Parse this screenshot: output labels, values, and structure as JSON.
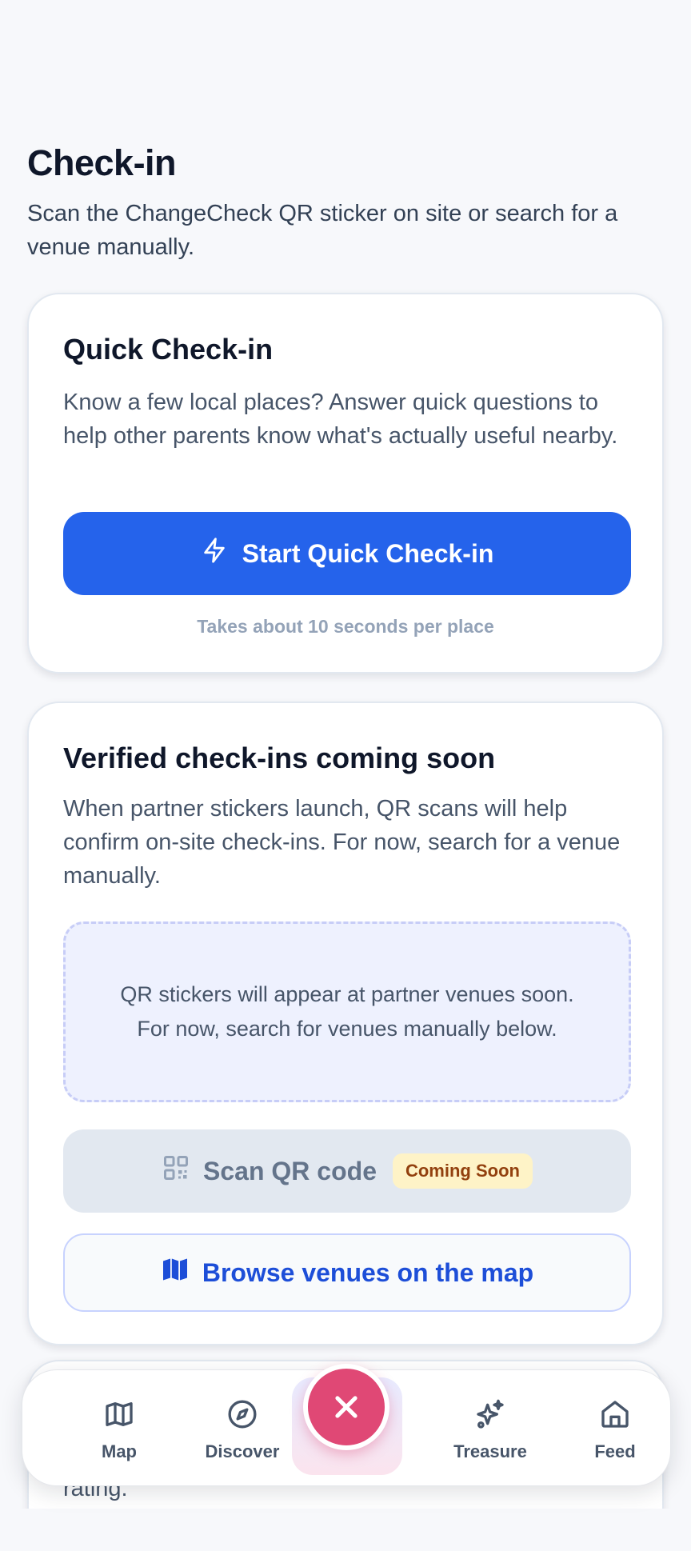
{
  "header": {
    "title": "Check-in",
    "subtitle": "Scan the ChangeCheck QR sticker on site or search for a venue manually."
  },
  "quick_checkin": {
    "title": "Quick Check-in",
    "description": "Know a few local places? Answer quick questions to help other parents know what's actually useful nearby.",
    "button_label": "Start Quick Check-in",
    "button_icon": "lightning-bolt-icon",
    "hint": "Takes about 10 seconds per place"
  },
  "verified": {
    "title": "Verified check-ins coming soon",
    "description": "When partner stickers launch, QR scans will help confirm on-site check-ins. For now, search for a venue manually.",
    "placeholder_line1": "QR stickers will appear at partner venues soon.",
    "placeholder_line2": "For now, search for venues manually below.",
    "scan_button_label": "Scan QR code",
    "scan_button_icon": "qr-code-icon",
    "scan_badge": "Coming Soon",
    "map_button_label": "Browse venues on the map",
    "map_button_icon": "map-icon"
  },
  "manual_search": {
    "partial_text": "Can't scan right now? Search for a venue to log a quick rating."
  },
  "tabbar": {
    "items": [
      {
        "label": "Map",
        "icon": "map-icon"
      },
      {
        "label": "Discover",
        "icon": "compass-icon"
      },
      {
        "label": "Treasure",
        "icon": "sparkles-icon"
      },
      {
        "label": "Feed",
        "icon": "home-icon"
      }
    ],
    "center_action_icon": "close-icon"
  },
  "colors": {
    "primary": "#2563eb",
    "accent": "#e04875",
    "badge_bg": "#fef3c7",
    "badge_text": "#92400e"
  }
}
